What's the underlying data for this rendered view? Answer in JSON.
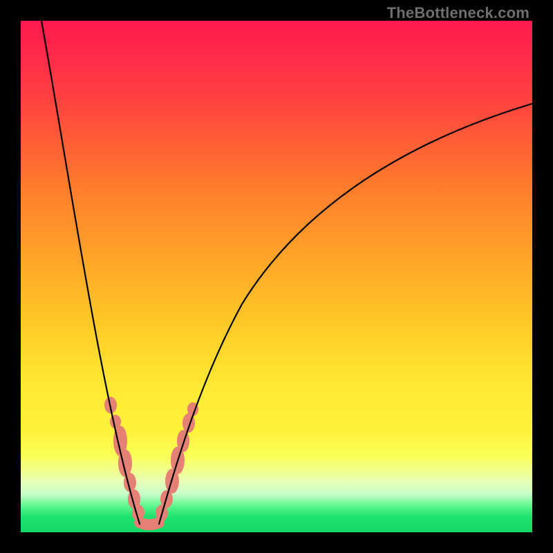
{
  "watermark": {
    "text": "TheBottleneck.com"
  },
  "colors": {
    "frame": "#000000",
    "curve": "#000000",
    "markers": "#e58074",
    "gradient_top": "#ff1a4d",
    "gradient_bottom": "#14d865"
  },
  "chart_data": {
    "type": "line",
    "title": "",
    "xlabel": "",
    "ylabel": "",
    "xlim": [
      0,
      100
    ],
    "ylim": [
      0,
      100
    ],
    "grid": false,
    "legend": false,
    "description": "V-shaped bottleneck curve against red-to-green vertical gradient. Left branch descends steeply from top-left; right branch rises with decreasing slope toward upper-right. Salmon-colored marker clusters sit along both branches near the trough and a flat salmon segment spans the bottom between the branches.",
    "series": [
      {
        "name": "left-branch",
        "x": [
          4,
          6,
          8,
          10,
          12,
          14,
          16,
          18,
          19,
          20,
          21,
          22,
          23
        ],
        "y": [
          100,
          88,
          75,
          62,
          50,
          40,
          31,
          21,
          16,
          12,
          8,
          5,
          2
        ]
      },
      {
        "name": "right-branch",
        "x": [
          27,
          28,
          29,
          31,
          34,
          38,
          44,
          52,
          60,
          70,
          80,
          90,
          100
        ],
        "y": [
          3,
          6,
          9,
          14,
          22,
          31,
          42,
          53,
          61,
          69,
          75,
          80,
          84
        ]
      }
    ],
    "markers": [
      {
        "branch": "left",
        "x": 17.5,
        "y": 26,
        "size": 10
      },
      {
        "branch": "left",
        "x": 18.5,
        "y": 22,
        "size": 8
      },
      {
        "branch": "left",
        "x": 19.5,
        "y": 17,
        "size": 14
      },
      {
        "branch": "left",
        "x": 20.3,
        "y": 13,
        "size": 14
      },
      {
        "branch": "left",
        "x": 21.0,
        "y": 9,
        "size": 10
      },
      {
        "branch": "left",
        "x": 21.8,
        "y": 6,
        "size": 12
      },
      {
        "branch": "left",
        "x": 22.5,
        "y": 3,
        "size": 10
      },
      {
        "branch": "right",
        "x": 27.5,
        "y": 4,
        "size": 10
      },
      {
        "branch": "right",
        "x": 28.5,
        "y": 7,
        "size": 10
      },
      {
        "branch": "right",
        "x": 29.5,
        "y": 11,
        "size": 12
      },
      {
        "branch": "right",
        "x": 30.5,
        "y": 15,
        "size": 14
      },
      {
        "branch": "right",
        "x": 31.5,
        "y": 19,
        "size": 12
      },
      {
        "branch": "right",
        "x": 32.5,
        "y": 22,
        "size": 10
      }
    ],
    "base_segment": {
      "x_start": 23,
      "x_end": 27,
      "y": 2
    }
  }
}
